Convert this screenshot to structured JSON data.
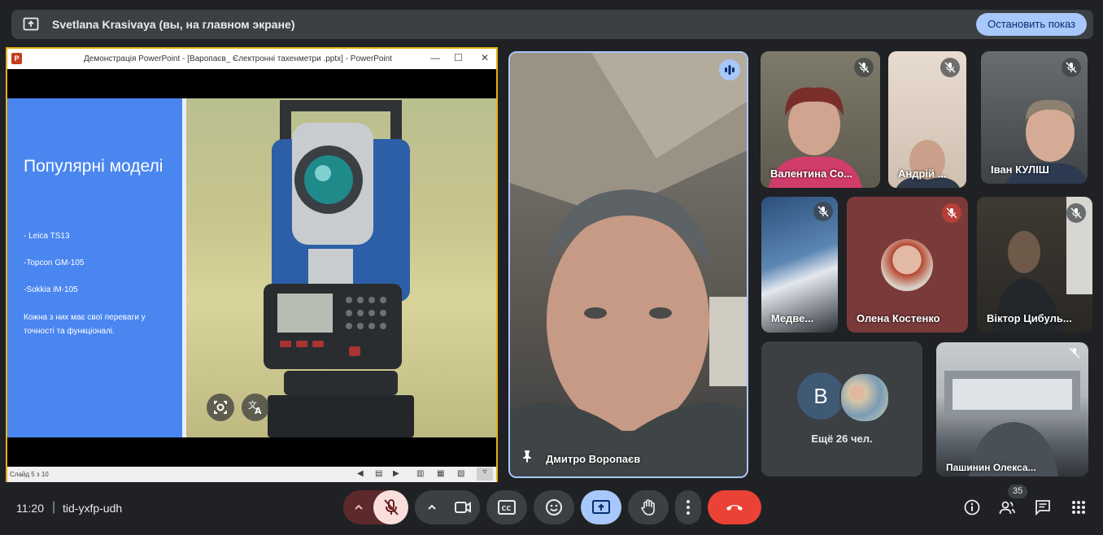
{
  "banner": {
    "text": "Svetlana Krasivaya (вы, на главном экране)",
    "stop_label": "Остановить показ",
    "icon": "present-screen-icon"
  },
  "ppt": {
    "title": "Демонстрація PowerPoint - [Варопаєв_ Єлектронні тахенметри .pptx] - PowerPoint",
    "app_icon_letter": "P",
    "status": "Слайд 5 з 10",
    "slide": {
      "title": "Популярні моделі",
      "items": [
        "- Leica TS13",
        "-Topcon GM-105",
        "-Sokkia iM-105"
      ],
      "description": "Кожна з них має свої переваги у точності та функціоналі."
    }
  },
  "main_tile": {
    "name": "Дмитро Воропаєв",
    "speaking_icon": "audio-level-icon",
    "pin_icon": "pin-icon"
  },
  "participants": [
    {
      "name": "Валентина Со...",
      "muted": true
    },
    {
      "name": "Андрій ...",
      "muted": true
    },
    {
      "name": "Іван КУЛІШ",
      "muted": true
    },
    {
      "name": "Медве...",
      "muted": true
    },
    {
      "name": "Олена Костенко",
      "muted": true
    },
    {
      "name": "Віктор Цибуль...",
      "muted": true
    }
  ],
  "more": {
    "avatar_letter": "B",
    "label": "Ещё 26 чел."
  },
  "last_tile": {
    "name": "Пашинин Олекса..."
  },
  "bottombar": {
    "time": "11:20",
    "separator": "|",
    "meeting_code": "tid-yxfp-udh",
    "participants_count": "35"
  },
  "colors": {
    "background": "#202124",
    "accent_blue": "#a8c7fa",
    "end_call_red": "#ea4335",
    "mic_off_bg": "#f9dedc"
  }
}
